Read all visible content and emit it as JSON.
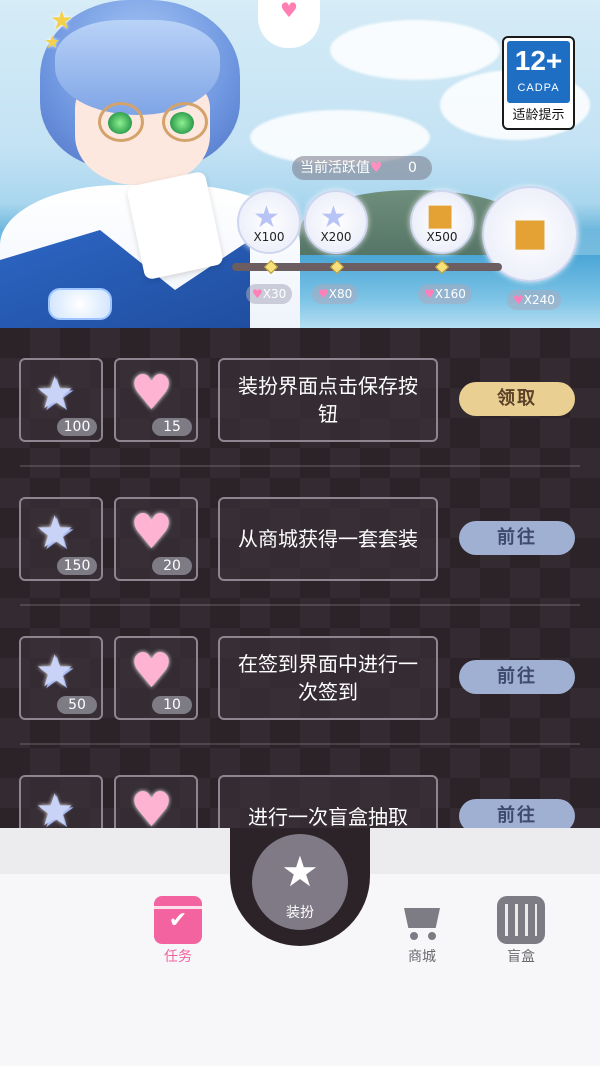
{
  "age_rating": {
    "number": "12+",
    "org": "CADPA",
    "tip": "适龄提示"
  },
  "activity": {
    "label": "当前活跃值",
    "value": "0",
    "rewards": [
      {
        "count": "X100",
        "type": "gem"
      },
      {
        "count": "X200",
        "type": "gem"
      },
      {
        "count": "X500",
        "type": "gift"
      },
      {
        "count": "",
        "type": "big-gift"
      }
    ],
    "milestones": [
      "X30",
      "X80",
      "X160",
      "X240"
    ]
  },
  "tasks": [
    {
      "gem": "100",
      "heart": "15",
      "desc": "装扮界面点击保存按钮",
      "button": "领取",
      "state": "claim"
    },
    {
      "gem": "150",
      "heart": "20",
      "desc": "从商城获得一套套装",
      "button": "前往",
      "state": "goto"
    },
    {
      "gem": "50",
      "heart": "10",
      "desc": "在签到界面中进行一次签到",
      "button": "前往",
      "state": "goto"
    },
    {
      "gem": "",
      "heart": "",
      "desc": "进行一次盲盒抽取",
      "button": "前往",
      "state": "goto"
    }
  ],
  "nav": {
    "tasks": "任务",
    "dress": "装扮",
    "shop": "商城",
    "blindbox": "盲盒"
  },
  "colors": {
    "accent": "#f263a0",
    "claim": "#e9cf91",
    "goto": "#9fb0d3",
    "panel": "#2b2328"
  }
}
